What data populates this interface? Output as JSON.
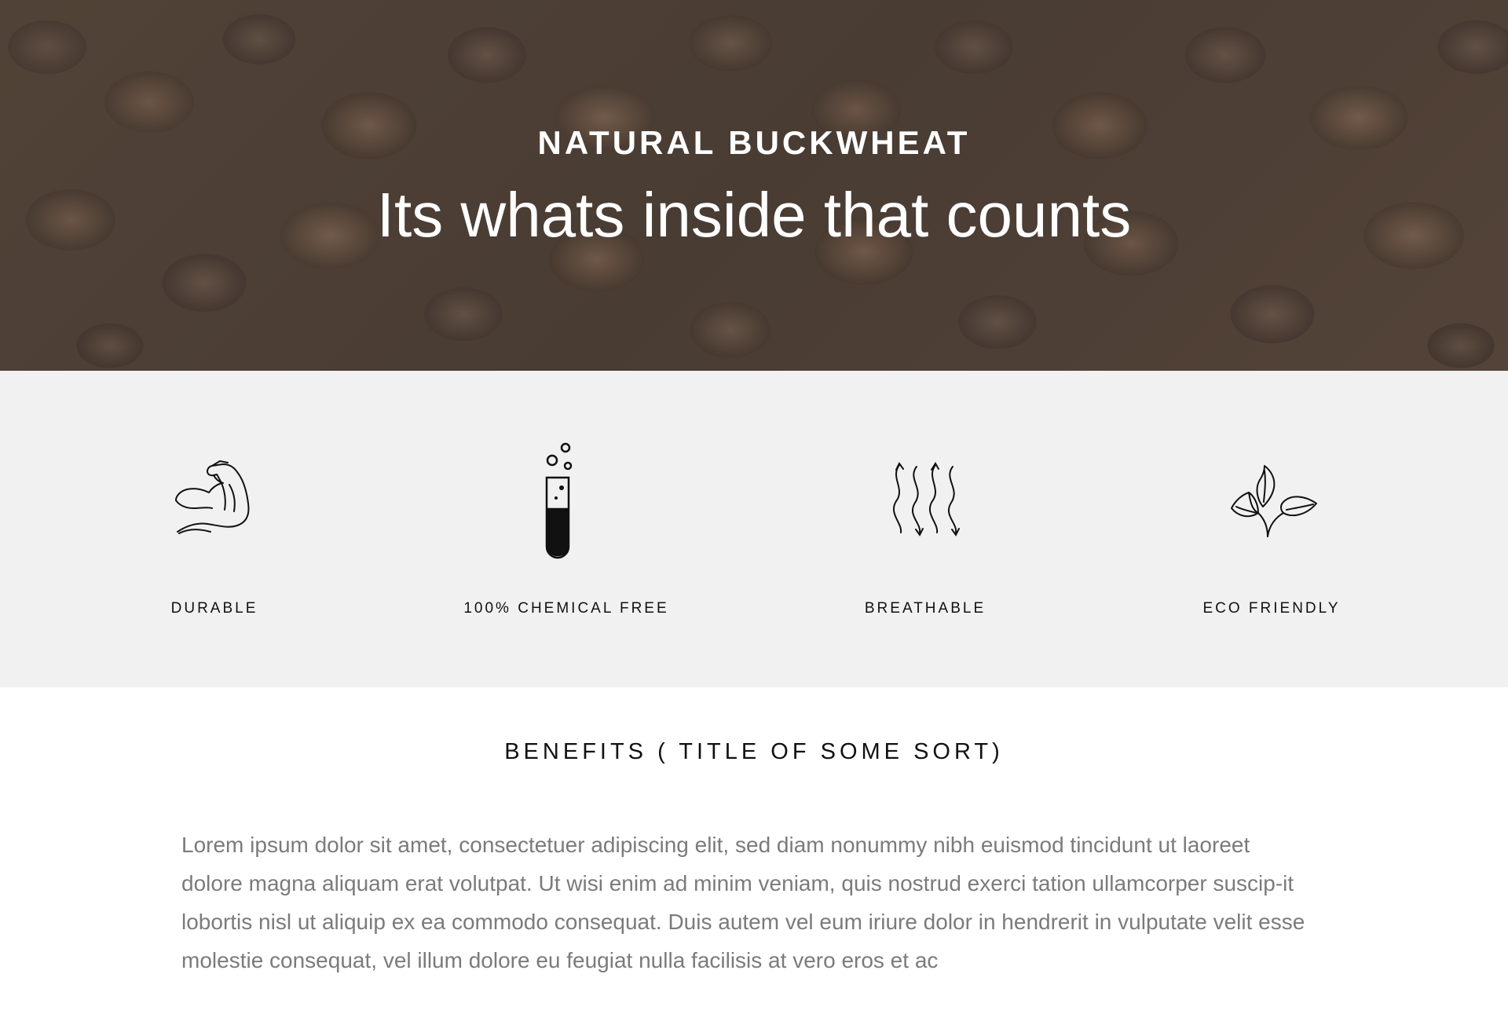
{
  "hero": {
    "eyebrow": "NATURAL BUCKWHEAT",
    "title": "Its whats inside that counts"
  },
  "features": [
    {
      "icon": "flexed-arm-icon",
      "label": "DURABLE"
    },
    {
      "icon": "test-tube-icon",
      "label": "100% CHEMICAL FREE"
    },
    {
      "icon": "airflow-icon",
      "label": "BREATHABLE"
    },
    {
      "icon": "leaf-sprout-icon",
      "label": "ECO FRIENDLY"
    }
  ],
  "benefits": {
    "title": "BENEFITS ( TITLE OF SOME SORT)",
    "body": "Lorem ipsum dolor sit amet, consectetuer adipiscing elit, sed diam nonummy nibh euismod tincidunt ut laoreet dolore magna aliquam erat volutpat. Ut wisi enim ad minim veniam, quis nostrud exerci tation ullamcorper suscip-it lobortis nisl ut aliquip ex ea commodo consequat. Duis autem vel eum iriure dolor in hendrerit in vulputate velit esse molestie consequat, vel illum dolore eu feugiat nulla facilisis at vero eros et ac"
  },
  "colors": {
    "hero_overlay": "#463c37",
    "features_bg": "#f1f1f1",
    "body_text": "#7b7b7b",
    "heading_text": "#111111"
  }
}
